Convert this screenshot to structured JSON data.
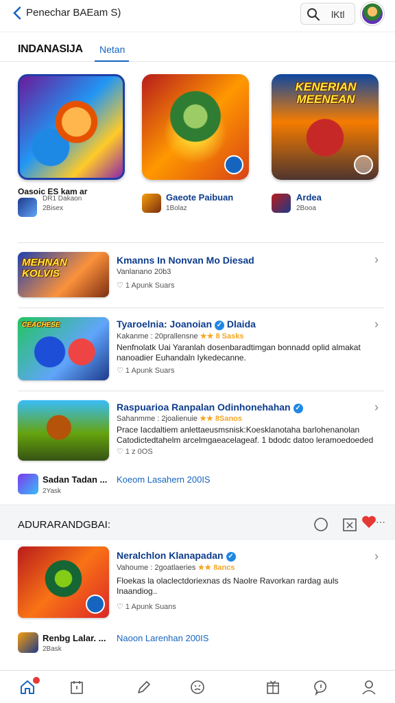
{
  "header": {
    "title": "Penechar BAEam S)",
    "search_text": "lKtl"
  },
  "tabs": {
    "main": "INDANASIJA",
    "active": "Netan"
  },
  "featured": [
    {
      "art_text": "",
      "caption": "Oasoic ES kam ar",
      "caption2": "DR1 Dakaon",
      "sub": "2Bisex"
    },
    {
      "art_text": "",
      "caption": "Gaeote Paibuan",
      "sub": "1Bolaz"
    },
    {
      "art_text": "KENERIAN MEENEAN",
      "caption": "Ardea",
      "sub": "2Booa"
    }
  ],
  "list": [
    {
      "thumb_text": "MEHNAN KOLVIS",
      "title": "Kmanns In Nonvan Mo Diesad",
      "sub": "Vanlanano 20b3",
      "meta": "♡ 1 Apunk  Suars"
    },
    {
      "thumb_text": "CEACHESE",
      "title": "Tyaroelnia: Joanoian",
      "title2": "Dlaida",
      "sub": "Kakanme : 20prallensne",
      "stars": "★★ 8 Sasks",
      "desc": "Nenfnolatk Uai Yaranlah dosenbaradtimgan bonnadd oplid almakat nanoadier Euhandaln Iykedecanne.",
      "meta": "♡ 1 Apunk  Suars"
    },
    {
      "thumb_text": "",
      "title": "Raspuarioa Ranpalan Odinhonehahan",
      "sub": "Sahanmme : 2joalienuie",
      "stars": "★★ 8Sanos",
      "desc": "Prace Iacdaltiem anlettaeusmsnisk:Koesklanotaha barlohenanolan Catodictedtahelm arcelmgaeacelageaf. 1 bdodc datoo leramoedoeded",
      "meta": "♡ 1 z 0OS"
    }
  ],
  "small_row1": {
    "title": "Sadan Tadan ...",
    "link": "Koeom Lasahern 200IS",
    "sub": "2Yask"
  },
  "section": {
    "title": "ADURARANDGBAI:"
  },
  "section_item": {
    "thumb_text": "",
    "title": "Neralchlon Klanapadan",
    "sub": "Vahoume : 2goatlaeries",
    "stars": "★★ 8ancs",
    "desc": "Floekas la olaclectdoriexnas ds Naolre Ravorkan rardag auls Inaandiog..",
    "meta": "♡ 1 Apunk  Suans"
  },
  "small_row2": {
    "title": "Renbg Lalar. ...",
    "link": "Naoon Larenhan 200IS",
    "sub": "2Bask"
  },
  "colors": {
    "accent": "#1565c0",
    "title_blue": "#0d3c8c",
    "star": "#f5a623",
    "badge_red": "#e53935"
  },
  "nav_icons": [
    "home-icon",
    "calendar-icon",
    "pen-icon",
    "face-icon",
    "gift-icon",
    "chat-icon",
    "profile-icon"
  ]
}
